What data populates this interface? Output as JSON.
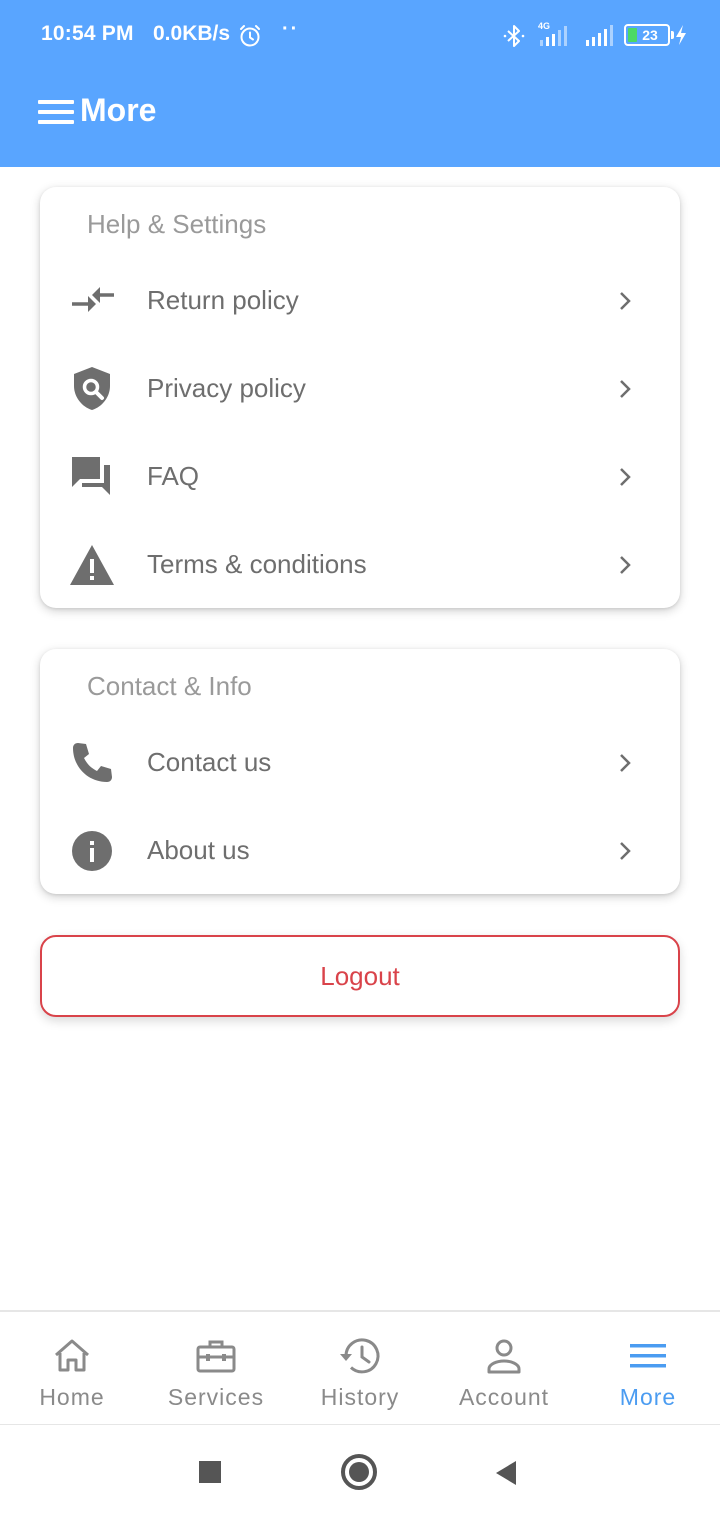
{
  "status_bar": {
    "time": "10:54 PM",
    "net_speed": "0.0KB/s",
    "network_type": "4G",
    "battery": "23"
  },
  "app_bar": {
    "title": "More",
    "background": "#59a5ff"
  },
  "help_settings": {
    "title": "Help & Settings",
    "items": [
      {
        "label": "Return policy",
        "icon": "compare-arrows-icon"
      },
      {
        "label": "Privacy policy",
        "icon": "shield-search-icon"
      },
      {
        "label": "FAQ",
        "icon": "forum-icon"
      },
      {
        "label": "Terms & conditions",
        "icon": "warning-icon"
      }
    ]
  },
  "contact_info": {
    "title": "Contact & Info",
    "items": [
      {
        "label": "Contact us",
        "icon": "phone-icon"
      },
      {
        "label": "About us",
        "icon": "info-icon"
      }
    ]
  },
  "logout": {
    "label": "Logout",
    "color": "#d9434a"
  },
  "bottom_nav": {
    "active_color": "#4b9cf1",
    "items": [
      {
        "label": "Home",
        "icon": "home-icon"
      },
      {
        "label": "Services",
        "icon": "toolbox-icon"
      },
      {
        "label": "History",
        "icon": "history-icon"
      },
      {
        "label": "Account",
        "icon": "account-icon"
      },
      {
        "label": "More",
        "icon": "menu-icon",
        "active": true
      }
    ]
  }
}
